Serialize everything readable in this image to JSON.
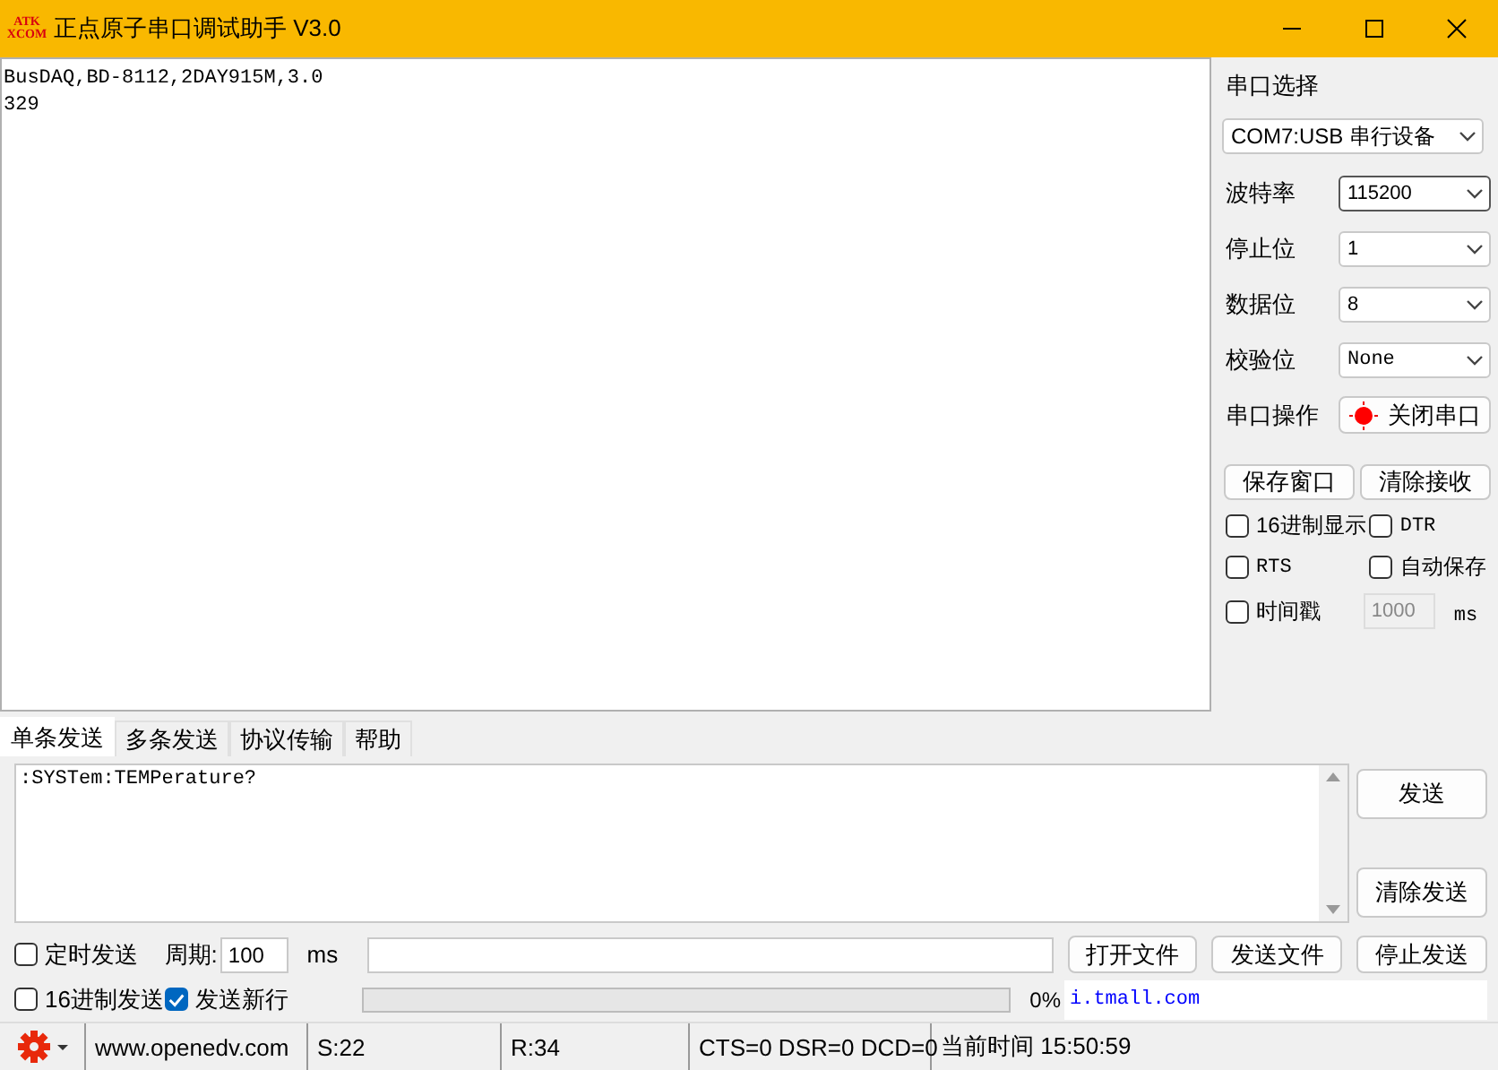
{
  "window": {
    "title": "正点原子串口调试助手 V3.0",
    "logo": [
      "ATK",
      "XCOM"
    ]
  },
  "receive": {
    "lines": [
      "BusDAQ,BD-8112,2DAY915M,3.0",
      "329"
    ]
  },
  "settings": {
    "port_label": "串口选择",
    "port": "COM7:USB 串行设备",
    "fields": [
      {
        "label": "波特率",
        "value": "115200"
      },
      {
        "label": "停止位",
        "value": "1"
      },
      {
        "label": "数据位",
        "value": "8"
      },
      {
        "label": "校验位",
        "value": "None"
      }
    ],
    "port_op": {
      "label": "串口操作",
      "button": "关闭串口",
      "open": true
    },
    "buttons": [
      "保存窗口",
      "清除接收"
    ],
    "options": [
      {
        "label": "16进制显示",
        "checked": false
      },
      {
        "label": "DTR",
        "checked": false
      },
      {
        "label": "RTS",
        "checked": false
      },
      {
        "label": "自动保存",
        "checked": false
      },
      {
        "label": "时间戳",
        "checked": false
      }
    ],
    "timestamp": {
      "value": "1000",
      "unit": "ms",
      "disabled": true
    }
  },
  "tabs": [
    {
      "label": "单条发送",
      "selected": true
    },
    {
      "label": "多条发送",
      "selected": false
    },
    {
      "label": "协议传输",
      "selected": false
    },
    {
      "label": "帮助",
      "selected": false
    }
  ],
  "send": {
    "text": ":SYSTem:TEMPerature?",
    "buttons": [
      "发送",
      "清除发送"
    ]
  },
  "controls": {
    "timed": {
      "label": "定时发送",
      "checked": false
    },
    "period_label": "周期:",
    "period": "100",
    "period_unit": "ms",
    "file_buttons": [
      "打开文件",
      "发送文件",
      "停止发送"
    ],
    "hex_send": {
      "label": "16进制发送",
      "checked": false
    },
    "newline": {
      "label": "发送新行",
      "checked": true
    },
    "progress": {
      "level": 0
    },
    "percent": "0%",
    "link": "i.tmall.com"
  },
  "status_bar": [
    "www.openedv.com",
    "S:22",
    "R:34",
    "CTS=0 DSR=0 DCD=0",
    "当前时间 15:50:59"
  ]
}
